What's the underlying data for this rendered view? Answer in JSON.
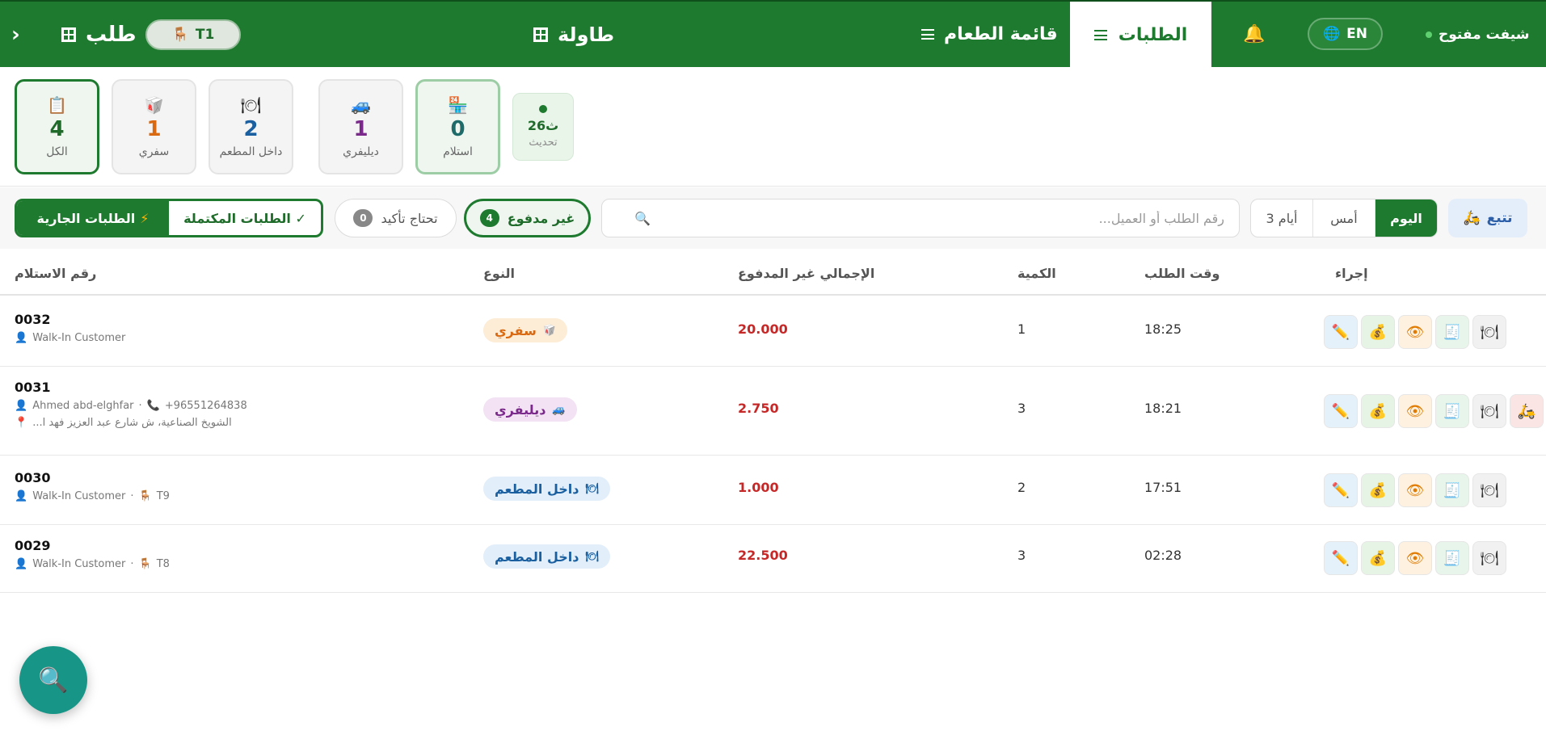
{
  "header": {
    "chevron": "›",
    "order_title": "طلب",
    "table_pill": "T1",
    "tables_label": "طاولة",
    "menu_label": "قائمة الطعام",
    "orders_label": "الطلبات",
    "lang_label": "EN",
    "shift_status": "شيفت مفتوح"
  },
  "stats": {
    "all": {
      "num": "4",
      "label": "الكل"
    },
    "safari": {
      "num": "1",
      "label": "سفري"
    },
    "dinein": {
      "num": "2",
      "label": "داخل المطعم"
    },
    "delivery": {
      "num": "1",
      "label": "ديليفري"
    },
    "pickup": {
      "num": "0",
      "label": "استلام"
    },
    "refresh": {
      "value": "26ث",
      "label": "تحديث"
    }
  },
  "colors": {
    "brand_green": "#1e7a2e",
    "safari": "#d96a12",
    "delivery": "#7b2a8c",
    "dinein": "#1a5f9f",
    "pickup": "#1e6b6a",
    "amount": "#c62828"
  },
  "filters": {
    "running_orders": "الطلبات الجارية",
    "completed_orders": "الطلبات المكتملة ✓",
    "needs_confirm": {
      "label": "تحتاج تأكيد",
      "count": "0"
    },
    "unpaid": {
      "label": "غير مدفوع",
      "count": "4"
    },
    "search_placeholder": "رقم الطلب أو العميل...",
    "date": {
      "days3": "3 أيام",
      "yesterday": "أمس",
      "today": "اليوم"
    },
    "track": "تتبع"
  },
  "table": {
    "headers": {
      "receipt": "رقم الاستلام",
      "type": "النوع",
      "unpaid_total": "الإجمالي غير المدفوع",
      "qty": "الكمية",
      "order_time": "وقت الطلب",
      "action": "إجراء"
    },
    "rows": [
      {
        "id": "0032",
        "customer": "Walk-In Customer",
        "type": "سفري",
        "amount": "20.000",
        "qty": "1",
        "time": "18:25"
      },
      {
        "id": "0031",
        "customer": "Ahmed abd-elghfar",
        "phone": "+96551264838",
        "address": "الشويخ الصناعية، ش شارع عبد العزيز فهد ا...",
        "type": "ديليفري",
        "amount": "2.750",
        "qty": "3",
        "time": "18:21"
      },
      {
        "id": "0030",
        "customer": "Walk-In Customer",
        "table": "T9",
        "type": "داخل المطعم",
        "amount": "1.000",
        "qty": "2",
        "time": "17:51"
      },
      {
        "id": "0029",
        "customer": "Walk-In Customer",
        "table": "T8",
        "type": "داخل المطعم",
        "amount": "22.500",
        "qty": "3",
        "time": "02:28"
      }
    ]
  },
  "icons": {
    "all": "clipboard-icon",
    "safari": "takeaway-icon",
    "dinein": "plate-icon",
    "delivery": "car-icon",
    "pickup": "store-icon",
    "track": "scooter-icon",
    "fab": "search-icon"
  }
}
